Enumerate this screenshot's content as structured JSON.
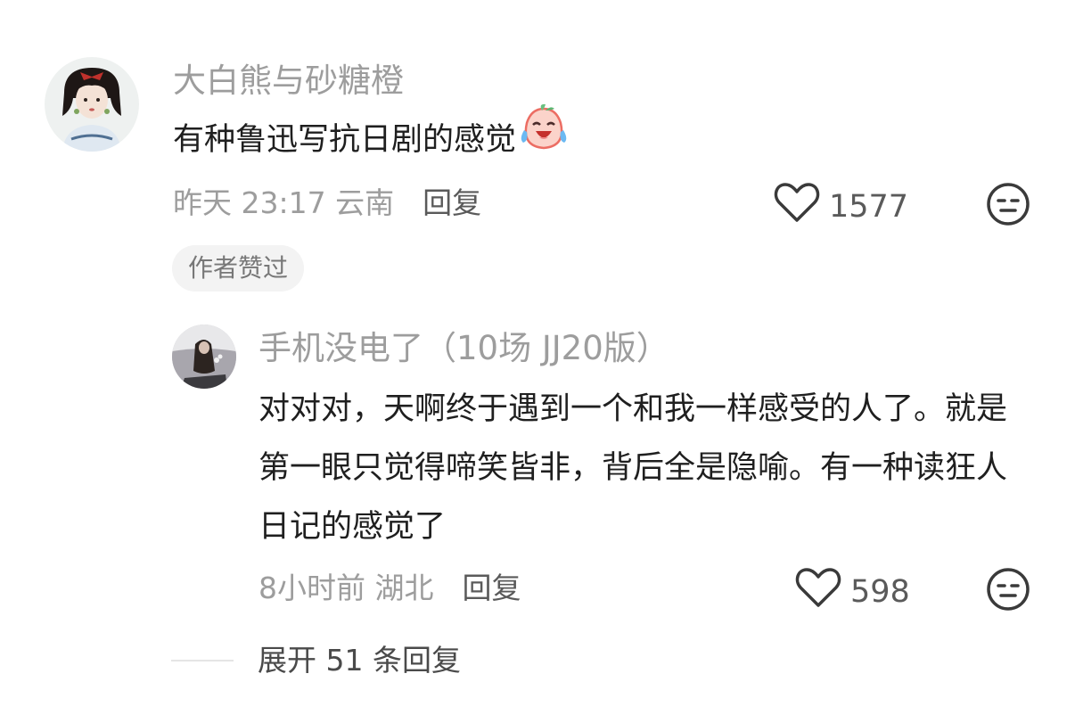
{
  "comments": {
    "main": {
      "username": "大白熊与砂糖橙",
      "text": "有种鲁迅写抗日剧的感觉",
      "emoji": "crying-laughing-peach-emoji",
      "meta": "昨天 23:17 云南",
      "reply_label": "回复",
      "likes": "1577",
      "badge": "作者赞过"
    },
    "reply": {
      "username": "手机没电了（10场 JJ20版）",
      "text": "对对对，天啊终于遇到一个和我一样感受的人了。就是第一眼只觉得啼笑皆非，背后全是隐喻。有一种读狂人日记的感觉了",
      "meta": "8小时前 湖北",
      "reply_label": "回复",
      "likes": "598"
    }
  },
  "expand": {
    "label": "展开 51 条回复"
  },
  "icons": {
    "like": "heart-outline-icon",
    "dislike": "unamused-face-icon"
  },
  "colors": {
    "username": "#9d9d9d",
    "text": "#1f1f1f",
    "meta": "#9d9d9d",
    "badge_bg": "#f3f3f3"
  }
}
